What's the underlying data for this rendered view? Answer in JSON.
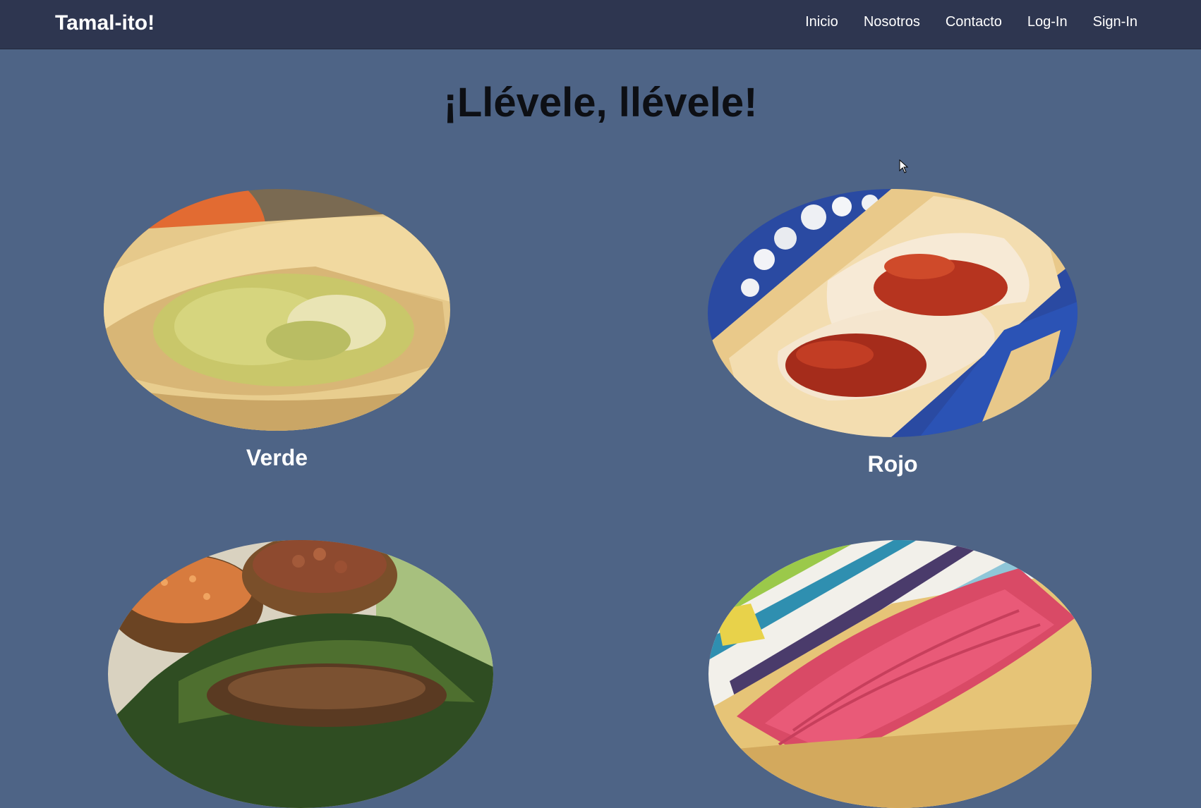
{
  "navbar": {
    "brand": "Tamal-ito!",
    "links": [
      "Inicio",
      "Nosotros",
      "Contacto",
      "Log-In",
      "Sign-In"
    ]
  },
  "hero": {
    "title": "¡Llévele, llévele!"
  },
  "products": [
    {
      "name": "Verde"
    },
    {
      "name": "Rojo"
    },
    {
      "name": ""
    },
    {
      "name": ""
    }
  ],
  "colors": {
    "page_background": "#4e6486",
    "navbar_background": "#2e3650",
    "title_text": "#0d0f14",
    "nav_text": "#ffffff"
  },
  "icons": [
    "mouse-cursor-icon"
  ]
}
